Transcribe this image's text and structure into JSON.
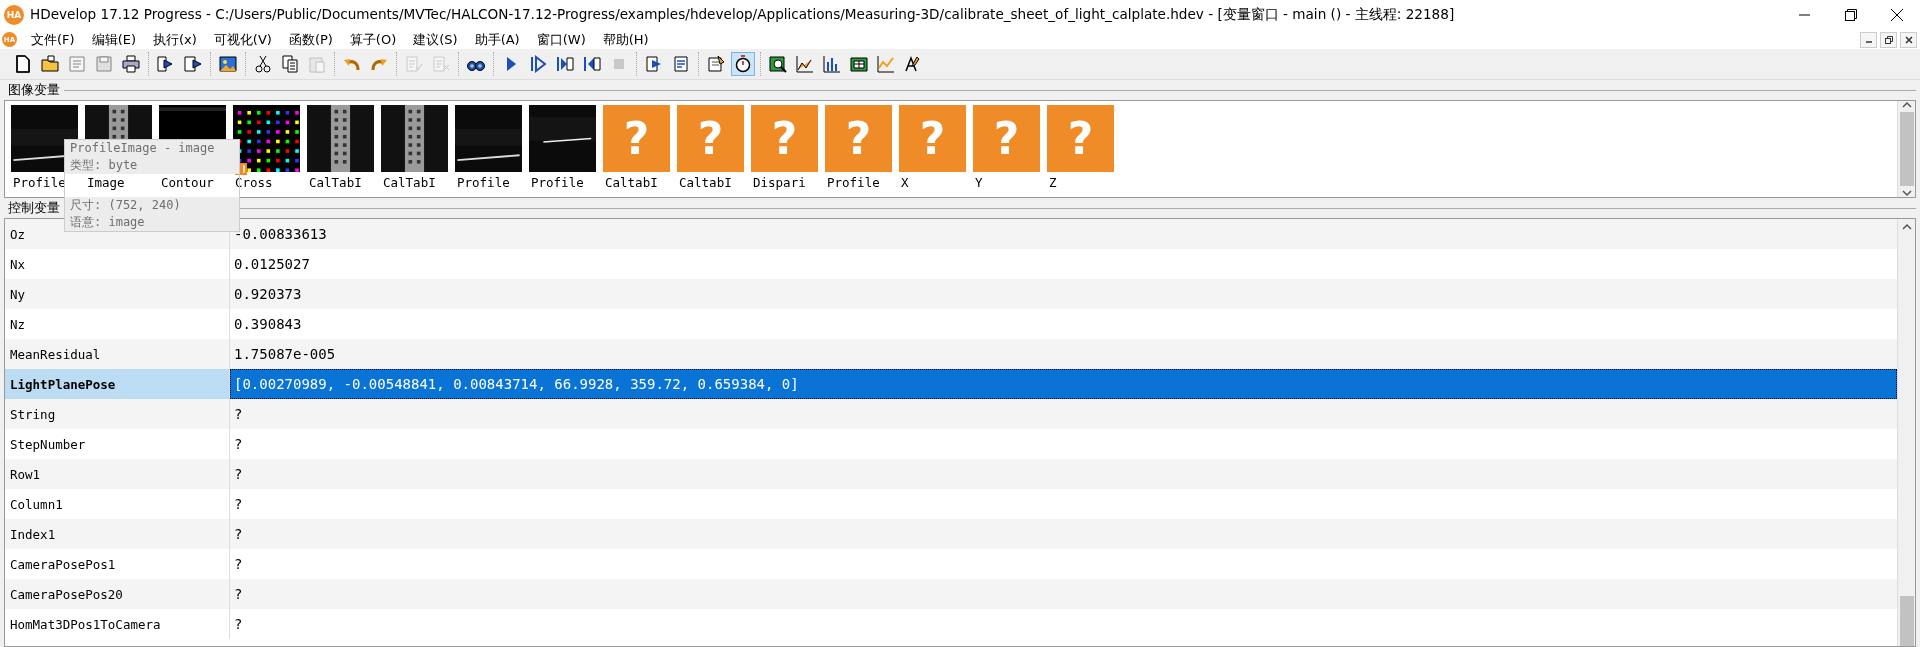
{
  "window": {
    "logo": "HA",
    "title": "HDevelop 17.12 Progress - C:/Users/Public/Documents/MVTec/HALCON-17.12-Progress/examples/hdevelop/Applications/Measuring-3D/calibrate_sheet_of_light_calplate.hdev - [变量窗口 - main () - 主线程: 22188]"
  },
  "menu": {
    "logo": "HA",
    "items": [
      "文件(F)",
      "编辑(E)",
      "执行(x)",
      "可视化(V)",
      "函数(P)",
      "算子(O)",
      "建议(S)",
      "助手(A)",
      "窗口(W)",
      "帮助(H)"
    ]
  },
  "toolbar": [
    [
      {
        "disabled": false,
        "on": false
      },
      {
        "disabled": false,
        "on": false
      },
      {
        "disabled": true,
        "on": false
      },
      {
        "disabled": true,
        "on": false
      },
      {
        "disabled": false,
        "on": false
      }
    ],
    [
      {
        "disabled": false,
        "on": false
      },
      {
        "disabled": false,
        "on": false
      }
    ],
    [
      {
        "disabled": false,
        "on": false
      }
    ],
    [
      {
        "disabled": false,
        "on": false
      },
      {
        "disabled": false,
        "on": false
      },
      {
        "disabled": true,
        "on": false
      }
    ],
    [
      {
        "disabled": false,
        "on": false
      },
      {
        "disabled": false,
        "on": false
      }
    ],
    [
      {
        "disabled": true,
        "on": false
      },
      {
        "disabled": true,
        "on": false
      }
    ],
    [
      {
        "disabled": false,
        "on": false
      }
    ],
    [
      {
        "disabled": false,
        "on": false
      },
      {
        "disabled": false,
        "on": false
      },
      {
        "disabled": false,
        "on": false
      },
      {
        "disabled": false,
        "on": false
      },
      {
        "disabled": true,
        "on": false
      }
    ],
    [
      {
        "disabled": false,
        "on": false
      },
      {
        "disabled": false,
        "on": false
      }
    ],
    [
      {
        "disabled": false,
        "on": false
      },
      {
        "disabled": false,
        "on": true
      }
    ],
    [
      {
        "disabled": false,
        "on": false
      },
      {
        "disabled": false,
        "on": false
      },
      {
        "disabled": false,
        "on": false
      },
      {
        "disabled": false,
        "on": false
      },
      {
        "disabled": false,
        "on": false
      },
      {
        "disabled": false,
        "on": false
      }
    ]
  ],
  "image_variables": {
    "heading": "图像变量",
    "items": [
      {
        "kind": "profile",
        "label": "Profile",
        "badge": false
      },
      {
        "kind": "plate",
        "label": "Image",
        "badge": false
      },
      {
        "kind": "dark",
        "label": "Contour",
        "badge": false
      },
      {
        "kind": "cross",
        "label": "Cross",
        "badge": true
      },
      {
        "kind": "plate",
        "label": "CalTabI",
        "badge": false
      },
      {
        "kind": "plate",
        "label": "CalTabI",
        "badge": false
      },
      {
        "kind": "profile",
        "label": "Profile",
        "badge": false
      },
      {
        "kind": "line",
        "label": "Profile",
        "badge": false
      },
      {
        "kind": "unknown",
        "mark": "?",
        "label": "CaltabI",
        "badge": false
      },
      {
        "kind": "unknown",
        "mark": "?",
        "label": "CaltabI",
        "badge": false
      },
      {
        "kind": "unknown",
        "mark": "?",
        "label": "Dispari",
        "badge": false
      },
      {
        "kind": "unknown",
        "mark": "?",
        "label": "Profile",
        "badge": false
      },
      {
        "kind": "unknown",
        "mark": "?",
        "label": "X",
        "badge": false
      },
      {
        "kind": "unknown",
        "mark": "?",
        "label": "Y",
        "badge": false
      },
      {
        "kind": "unknown",
        "mark": "?",
        "label": "Z",
        "badge": false
      }
    ]
  },
  "tooltip": [
    "ProfileImage - image",
    "类型: byte",
    "尺寸: (752, 240)",
    "语意: image"
  ],
  "control_variables": {
    "heading": "控制变量",
    "rows": [
      {
        "name": "Oz",
        "value": "-0.00833613",
        "selected": false
      },
      {
        "name": "Nx",
        "value": "0.0125027",
        "selected": false
      },
      {
        "name": "Ny",
        "value": "0.920373",
        "selected": false
      },
      {
        "name": "Nz",
        "value": "0.390843",
        "selected": false
      },
      {
        "name": "MeanResidual",
        "value": "1.75087e-005",
        "selected": false
      },
      {
        "name": "LightPlanePose",
        "value": "[0.00270989, -0.00548841, 0.00843714, 66.9928, 359.72, 0.659384, 0]",
        "selected": true
      },
      {
        "name": "String",
        "value": "?",
        "selected": false
      },
      {
        "name": "StepNumber",
        "value": "?",
        "selected": false
      },
      {
        "name": "Row1",
        "value": "?",
        "selected": false
      },
      {
        "name": "Column1",
        "value": "?",
        "selected": false
      },
      {
        "name": "Index1",
        "value": "?",
        "selected": false
      },
      {
        "name": "CameraPosePos1",
        "value": "?",
        "selected": false
      },
      {
        "name": "CameraPosePos20",
        "value": "?",
        "selected": false
      },
      {
        "name": "HomMat3DPos1ToCamera",
        "value": "?",
        "selected": false
      }
    ]
  }
}
